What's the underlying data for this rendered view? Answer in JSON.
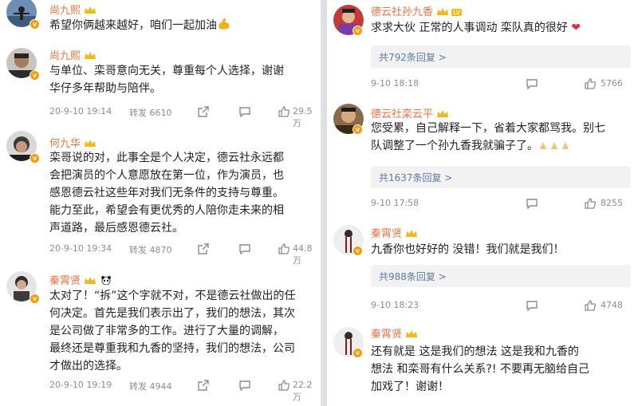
{
  "left": {
    "p0": {
      "user": "尚九熙",
      "lines": [
        "希望你俩越来越好，咱们一起加油"
      ]
    },
    "p1": {
      "user": "尚九熙",
      "lines": [
        "与单位、栾哥意向无关，尊重每个人选择，谢谢",
        "华仔多年帮助与陪伴。"
      ],
      "time": "20-9-10 19:14",
      "repost": "转发 6610",
      "likes": "29.5万"
    },
    "p2": {
      "user": "何九华",
      "lines": [
        "栾哥说的对，此事全是个人决定，德云社永远都",
        "会把演员的个人意愿放在第一位，作为演员，也",
        "感恩德云社这些年对我们无条件的支持与尊重。",
        "能力至此，希望会有更优秀的人陪你走未来的相",
        "声道路，最后感恩德云社。"
      ],
      "time": "20-9-10 19:34",
      "repost": "转发 4870",
      "likes": "44.8万"
    },
    "p3": {
      "user": "秦霄贤",
      "lines": [
        "太对了！“拆”这个字就不对，不是德云社做出的任",
        "何决定。首先是我们表示出了，我们的想法，其次",
        "是公司做了非常多的工作。进行了大量的调解，",
        "最终还是尊重我和九香的坚持，我们的想法，公司",
        "才做出的选择。"
      ],
      "time": "20-9-10 19:19",
      "repost": "转发 4944",
      "likes": "22.2万"
    }
  },
  "right": {
    "p0": {
      "user": "德云社孙九香",
      "badge": "LV",
      "lines": [
        "求求大伙 正常的人事调动 栾队真的很好"
      ],
      "replies": "共792条回复 >",
      "time": "9-10 18:18",
      "likes": "5766"
    },
    "p1": {
      "user": "德云社栾云平",
      "lines": [
        "您受累，自己解释一下，省着大家都骂我。别七",
        "队调整了一个孙九香我就骗子了。"
      ],
      "replies": "共1637条回复 >",
      "time": "9-10 17:58",
      "likes": "8255"
    },
    "p2": {
      "user": "秦霄贤",
      "lines": [
        "九香你也好好的  没错！我们就是我们！"
      ],
      "replies": "共988条回复 >",
      "time": "9-10 18:23",
      "likes": "4748"
    },
    "p3": {
      "user": "秦霄贤",
      "lines": [
        "还有就是 这是我们的想法  这是我和九香的",
        "想法  和栾哥有什么关系?! 不要再无脑给自己",
        "加戏了！谢谢！"
      ]
    }
  },
  "colors": {
    "username": "#eb7340",
    "link": "#5d7ba3",
    "meta": "#8c8c8c",
    "badge": "#f59b0c"
  },
  "icons": [
    "share-icon",
    "comment-icon",
    "like-icon",
    "verified-badge-icon",
    "crown-icon",
    "heart-icon",
    "flex-emoji-icon",
    "clap-emoji-icon"
  ]
}
